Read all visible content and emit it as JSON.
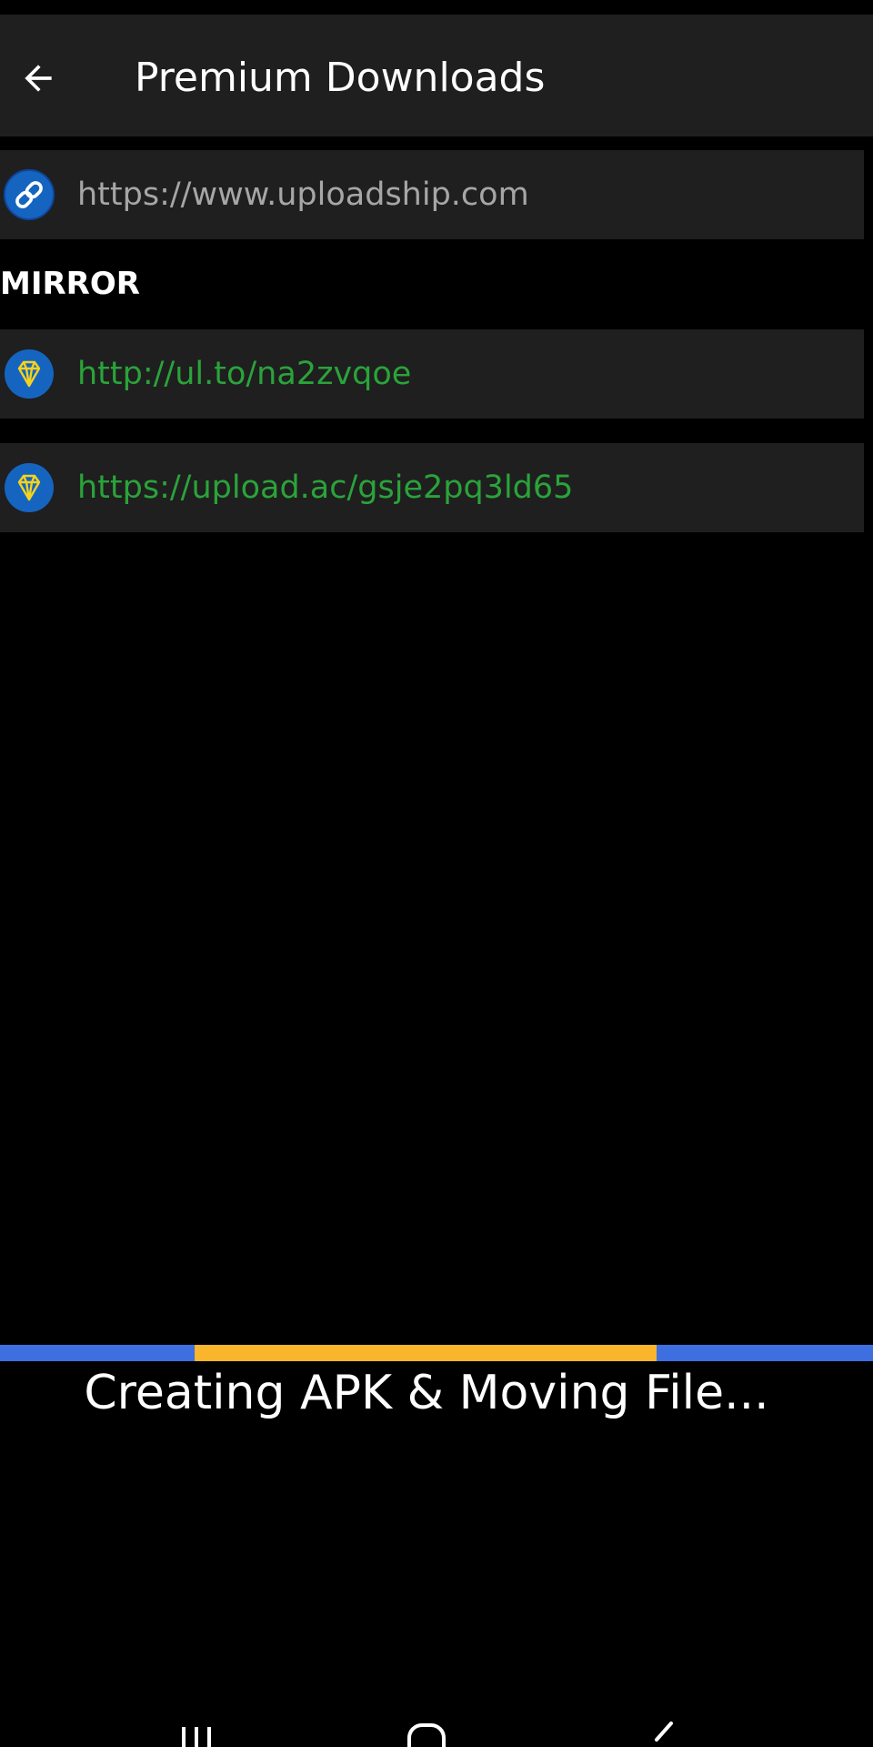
{
  "app_bar": {
    "title": "Premium Downloads",
    "back_icon": "arrow-left-icon"
  },
  "primary_link": {
    "url": "https://www.uploadship.com",
    "icon": "link-icon",
    "icon_bg": "#1565c0",
    "text_color": "#a6a6a6"
  },
  "mirror_section": {
    "label": "MIRROR",
    "items": [
      {
        "url": "http://ul.to/na2zvqoe",
        "icon": "diamond-icon"
      },
      {
        "url": "https://upload.ac/gsje2pq3ld65",
        "icon": "diamond-icon"
      }
    ],
    "text_color": "#2aa33a"
  },
  "progress": {
    "message": "Creating APK & Moving File...",
    "track_color": "#3d6fe0",
    "indicator_color": "#f9b52c",
    "indeterminate": true
  },
  "nav_bar": {
    "buttons": [
      "recent-apps-icon",
      "home-icon",
      "back-icon"
    ]
  }
}
